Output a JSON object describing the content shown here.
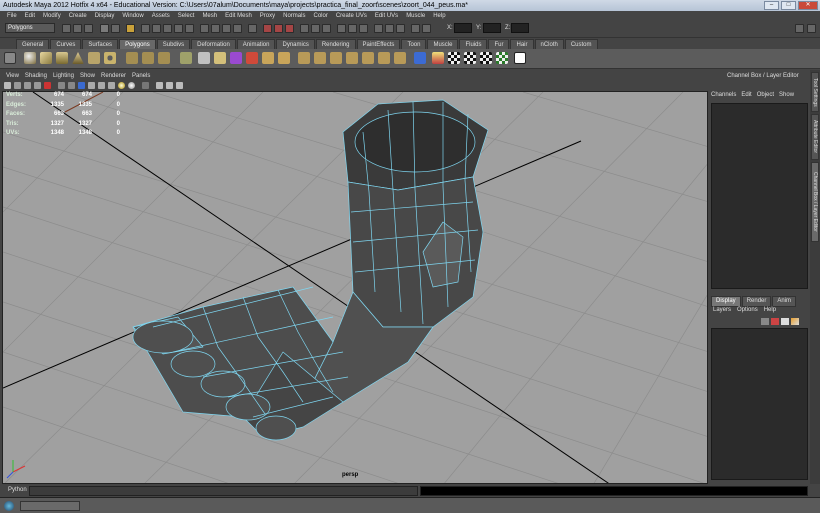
{
  "window": {
    "title": "Autodesk Maya 2012 Hotfix 4 x64 - Educational Version: C:\\Users\\07alum\\Documents\\maya\\projects\\practica_final_zoort\\scenes\\zoort_044_peus.ma*",
    "minimize": "–",
    "maximize": "□",
    "close": "✕"
  },
  "menubar": [
    "File",
    "Edit",
    "Modify",
    "Create",
    "Display",
    "Window",
    "Assets",
    "Select",
    "Mesh",
    "Edit Mesh",
    "Proxy",
    "Normals",
    "Color",
    "Create UVs",
    "Edit UVs",
    "Muscle",
    "Help"
  ],
  "status_line": {
    "mode": "Polygons",
    "x_label": "X:",
    "y_label": "Y:",
    "z_label": "Z:"
  },
  "shelf_tabs": {
    "items": [
      "General",
      "Curves",
      "Surfaces",
      "Polygons",
      "Subdivs",
      "Deformation",
      "Animation",
      "Dynamics",
      "Rendering",
      "PaintEffects",
      "Toon",
      "Muscle",
      "Fluids",
      "Fur",
      "Hair",
      "nCloth",
      "Custom"
    ],
    "active": "Polygons"
  },
  "panel_menu": [
    "View",
    "Shading",
    "Lighting",
    "Show",
    "Renderer",
    "Panels"
  ],
  "hud": {
    "rows": [
      {
        "label": "Verts:",
        "a": "674",
        "b": "674",
        "c": "0"
      },
      {
        "label": "Edges:",
        "a": "1335",
        "b": "1335",
        "c": "0"
      },
      {
        "label": "Faces:",
        "a": "663",
        "b": "663",
        "c": "0"
      },
      {
        "label": "Tris:",
        "a": "1327",
        "b": "1327",
        "c": "0"
      },
      {
        "label": "UVs:",
        "a": "1348",
        "b": "1348",
        "c": "0"
      }
    ]
  },
  "viewport": {
    "camera": "persp"
  },
  "channel_box": {
    "title": "Channel Box / Layer Editor",
    "menu": [
      "Channels",
      "Edit",
      "Object",
      "Show"
    ]
  },
  "layer_editor": {
    "tabs": [
      "Display",
      "Render",
      "Anim"
    ],
    "active_tab": "Display",
    "menu": [
      "Layers",
      "Options",
      "Help"
    ]
  },
  "side_tabs": [
    "Tool Settings",
    "Attribute Editor",
    "Channel Box / Layer Editor"
  ],
  "command_line": {
    "label": "Python"
  },
  "colors": {
    "viewport_bg": "#a0a0a0",
    "mesh": "#4a4a4a",
    "wire": "#7fd6f0",
    "grid": "#8c8c8c"
  }
}
